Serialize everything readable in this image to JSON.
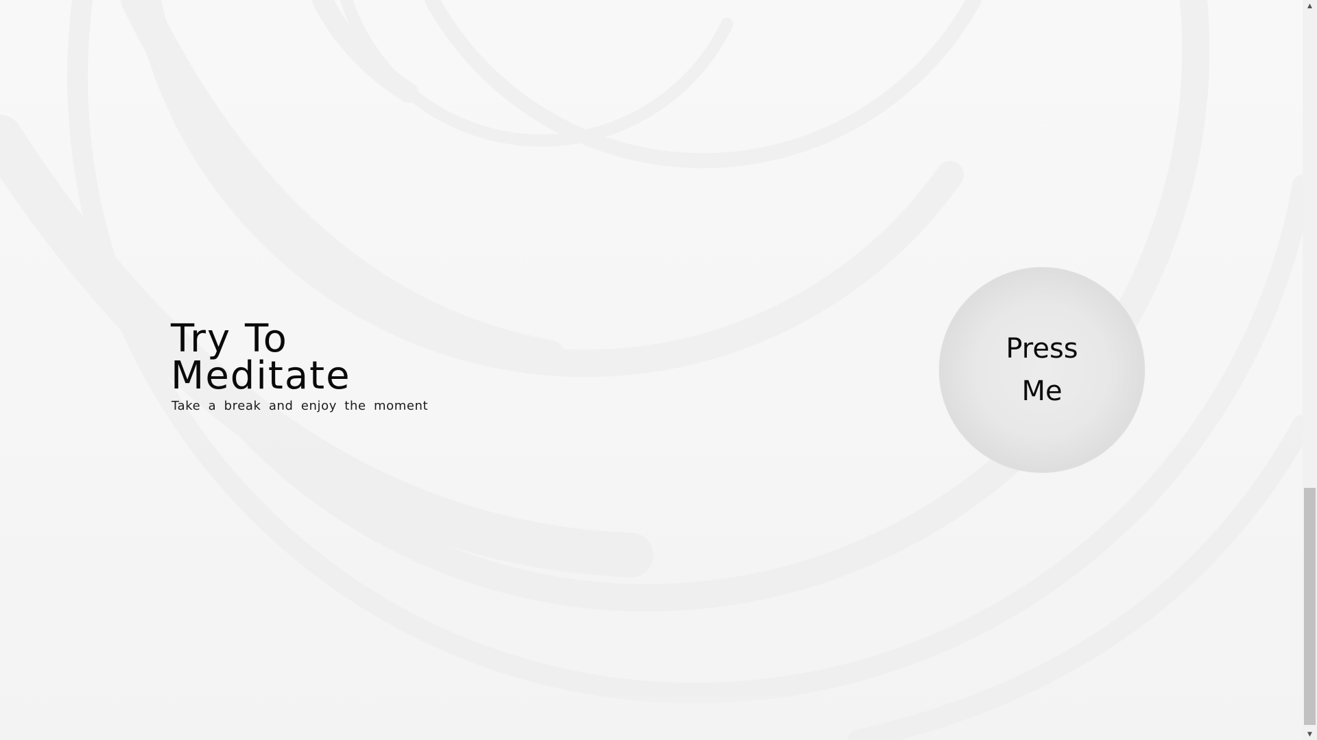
{
  "hero": {
    "title_line1": "Try To",
    "title_line2": "Meditate",
    "subtitle": "Take a break and enjoy the moment"
  },
  "press_button": {
    "label": "Press Me"
  },
  "scrollbar": {
    "up_arrow": "▲",
    "down_arrow": "▼"
  },
  "colors": {
    "background": "#f6f6f6",
    "arc": "#efefef",
    "button_fill": "#e5e5e5",
    "text": "#0a0a0a"
  }
}
